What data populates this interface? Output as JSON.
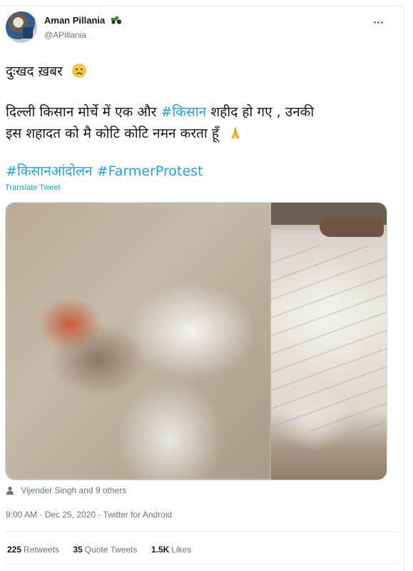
{
  "tweet": {
    "author": {
      "display_name": "Aman Pillania",
      "handle": "@APillania",
      "badge_icon": "tractor-icon"
    },
    "more_icon": "more-options-icon",
    "text_line1": "दुःखद ख़बर",
    "text_line2_a": "दिल्ली किसान मोर्चे में एक और ",
    "hashtag_kisan": "#किसान",
    "text_line2_b": "  शहीद हो गए , उनकी",
    "text_line3": "इस शहादत को मै कोटि कोटि नमन करता हूँ",
    "hashtags": [
      "#किसानआंदोलन",
      "#FarmerProtest"
    ],
    "translate_label": "Translate Tweet",
    "media_icon": "photo-media",
    "liked_by": "Vijender Singh and 9 others",
    "timestamp": "9:00 AM · Dec 25, 2020 · Twitter for Android",
    "stats": {
      "retweets_count": "225",
      "retweets_label": "Retweets",
      "quotes_count": "35",
      "quotes_label": "Quote Tweets",
      "likes_count": "1.5K",
      "likes_label": "Likes"
    }
  },
  "colors": {
    "link": "#1da1f2",
    "secondary_text": "#657786",
    "primary_text": "#14171a"
  }
}
